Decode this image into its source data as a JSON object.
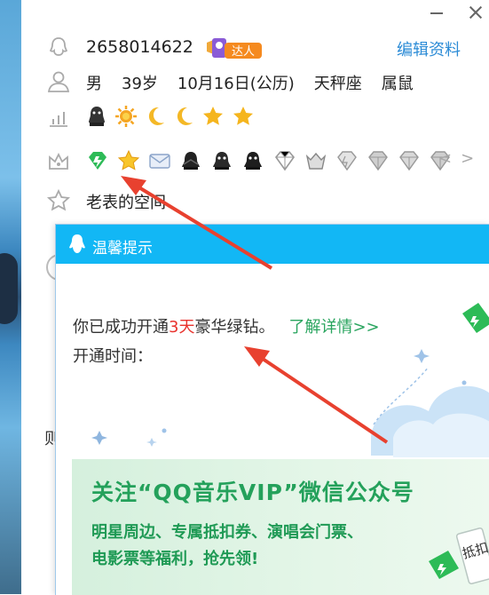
{
  "window": {
    "minimize_label": "",
    "close_label": ""
  },
  "profile": {
    "qq_number": "2658014622",
    "badge_label": "达人",
    "edit_link": "编辑资料",
    "gender": "男",
    "age": "39岁",
    "birthday": "10月16日(公历)",
    "zodiac": "天秤座",
    "chinese_zodiac": "属鼠",
    "level_icon_names": [
      "sun-icon",
      "moon-icon",
      "moon-icon",
      "star-icon",
      "star-icon"
    ],
    "space_link": "老表的空间",
    "cut_text": "则"
  },
  "vip_icons": [
    "green-diamond-icon",
    "yellow-star-icon",
    "mail-icon",
    "penguin-dark-icon",
    "penguin-dark-icon",
    "penguin-dark-icon",
    "gray-diamond-icon",
    "gray-crown-diamond-icon",
    "gray-diamond-icon",
    "gray-diamond-icon",
    "gray-diamond-icon",
    "gray-diamond-icon"
  ],
  "nav": {
    "prev": "<",
    "next": ">"
  },
  "popup": {
    "title": "温馨提示",
    "msg_pre": "你已成功开通",
    "msg_days": "3天",
    "msg_post": "豪华绿钻。",
    "more_link": "了解详情>>",
    "time_label": "开通时间："
  },
  "banner": {
    "headline": "关注“QQ音乐VIP”微信公众号",
    "line1": "明星周边、专属抵扣券、演唱会门票、",
    "line2": "电影票等福利，抢先领!",
    "ticket_text": "抵扣"
  },
  "colors": {
    "accent": "#12b7f5",
    "link": "#2b8bd6",
    "green": "#24a15b",
    "red": "#e8322d",
    "arrow": "#e8412f"
  }
}
